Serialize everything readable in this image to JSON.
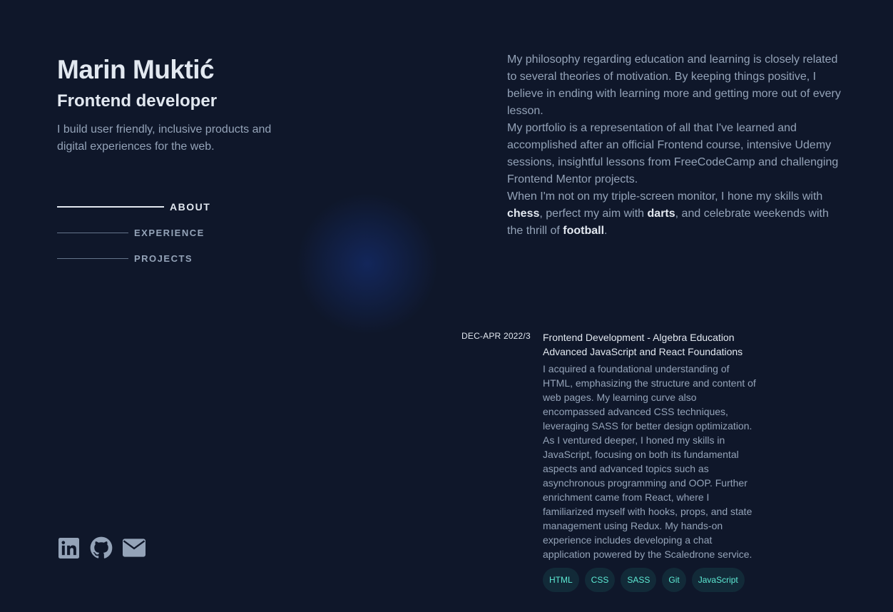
{
  "profile": {
    "name": "Marin Muktić",
    "role": "Frontend developer",
    "tagline": "I build user friendly, inclusive products and digital experiences for the web."
  },
  "nav": [
    {
      "label": "ABOUT",
      "active": true
    },
    {
      "label": "EXPERIENCE",
      "active": false
    },
    {
      "label": "PROJECTS",
      "active": false
    }
  ],
  "socials": [
    {
      "icon": "linkedin-icon"
    },
    {
      "icon": "github-icon"
    },
    {
      "icon": "mail-icon"
    }
  ],
  "about": {
    "p1": "My philosophy regarding education and learning is closely related to several theories of motivation. By keeping things positive, I believe in ending with learning more and getting more out of every lesson.",
    "p2": "My portfolio is a representation of all that I've learned and accomplished after an official Frontend course, intensive Udemy sessions, insightful lessons from FreeCodeCamp and challenging Frontend Mentor projects.",
    "p3_a": "When I'm not on my triple-screen monitor, I hone my skills with ",
    "p3_chess": "chess",
    "p3_b": ", perfect my aim with ",
    "p3_darts": "darts",
    "p3_c": ", and celebrate weekends with the thrill of ",
    "p3_football": "football",
    "p3_d": "."
  },
  "experience": {
    "date": "DEC-APR 2022/3",
    "title_line1": "Frontend Development - Algebra Education",
    "title_line2": "Advanced JavaScript and React Foundations",
    "description": "I acquired a foundational understanding of HTML, emphasizing the structure and content of web pages. My learning curve also encompassed advanced CSS techniques, leveraging SASS for better design optimization. As I ventured deeper, I honed my skills in JavaScript, focusing on both its fundamental aspects and advanced topics such as asynchronous programming and OOP. Further enrichment came from React, where I familiarized myself with hooks, props, and state management using Redux. My hands-on experience includes developing a chat application powered by the Scaledrone service.",
    "tags": [
      "HTML",
      "CSS",
      "SASS",
      "Git",
      "JavaScript"
    ]
  },
  "colors": {
    "background": "#0f172a",
    "heading": "#e2e8f0",
    "body": "#94a3b8",
    "accent": "#5eead4"
  }
}
